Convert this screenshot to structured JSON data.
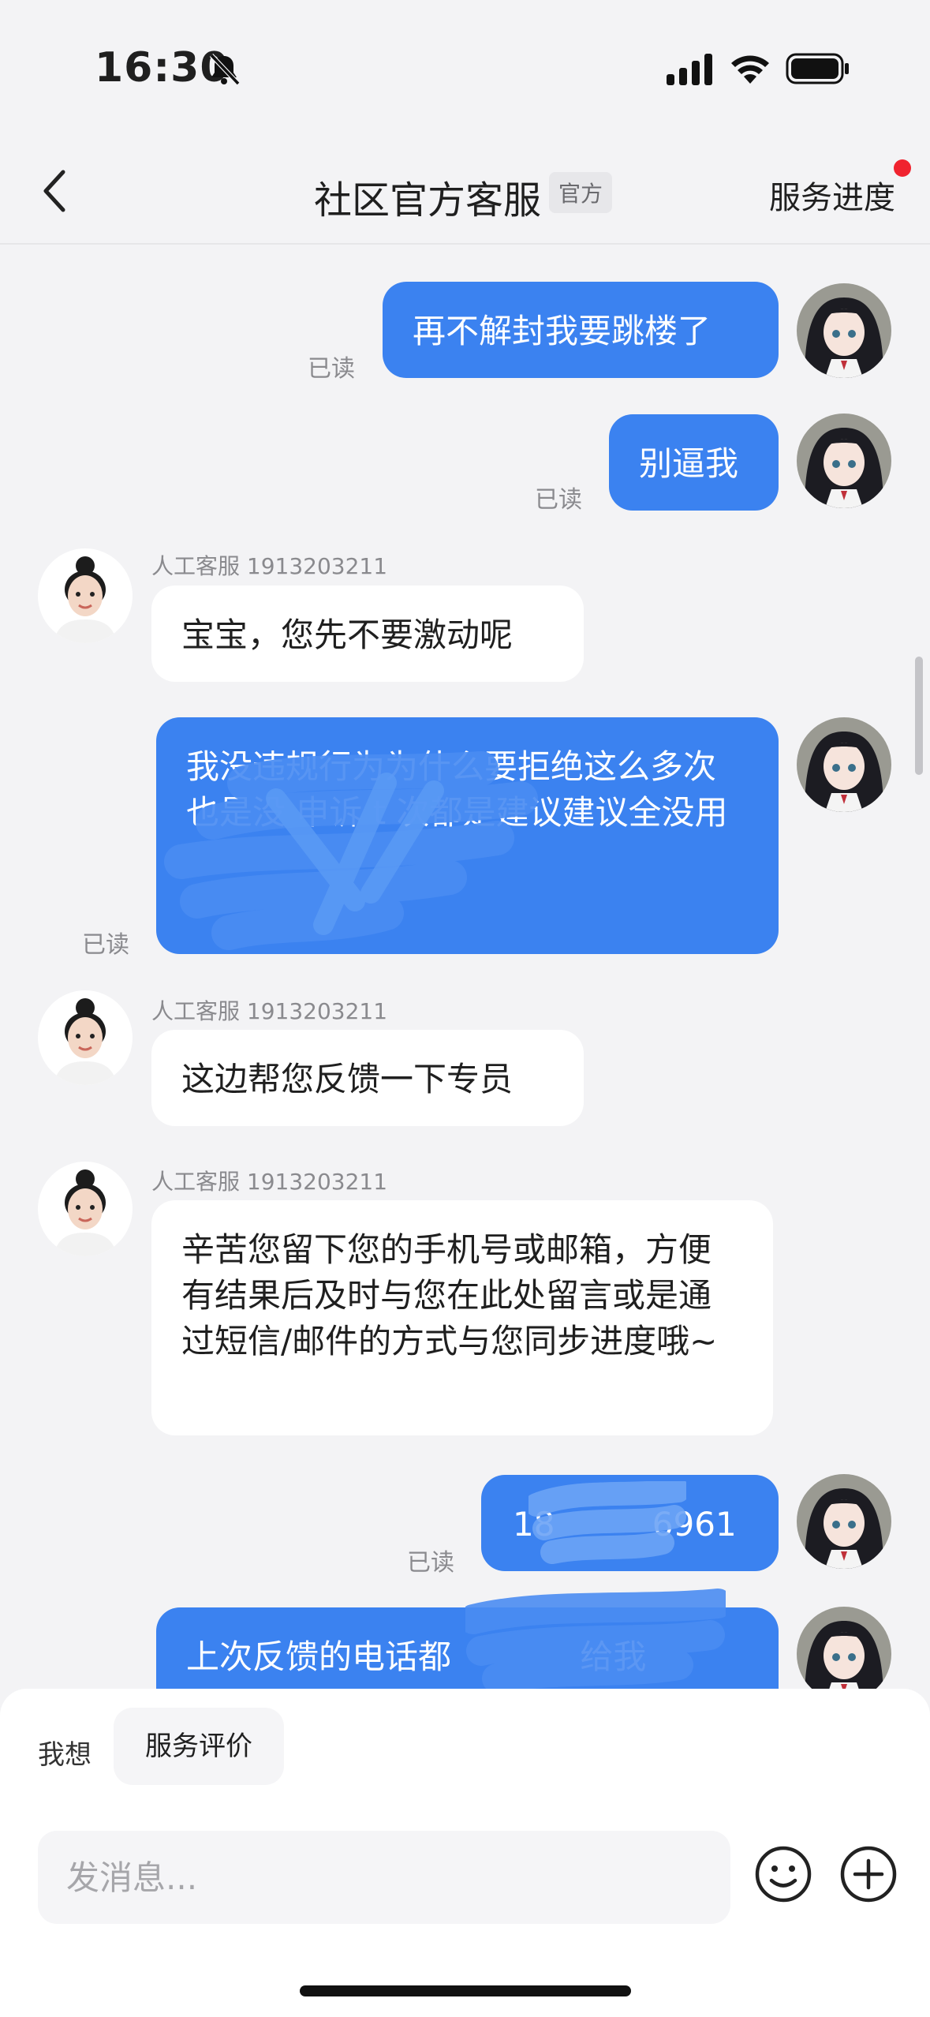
{
  "status_bar": {
    "time": "16:30"
  },
  "header": {
    "title": "社区官方客服",
    "badge": "官方",
    "right_link": "服务进度"
  },
  "messages": [
    {
      "direction": "out",
      "text": "再不解封我要跳楼了",
      "status": "已读"
    },
    {
      "direction": "out",
      "text": "别逼我",
      "status": "已读"
    },
    {
      "direction": "in",
      "sender": "人工客服 1913203211",
      "text": "宝宝，您先不要激动呢"
    },
    {
      "direction": "out",
      "text": "我没违规行为为什么要拒绝这么多次 也是没 申诉 t 次都是建议建议全没用",
      "status": "已读"
    },
    {
      "direction": "in",
      "sender": "人工客服 1913203211",
      "text": "这边帮您反馈一下专员"
    },
    {
      "direction": "in",
      "sender": "人工客服 1913203211",
      "text": "辛苦您留下您的手机号或邮箱，方便有结果后及时与您在此处留言或是通过短信/邮件的方式与您同步进度哦~"
    },
    {
      "direction": "out",
      "text": "18 6961",
      "status": "已读"
    },
    {
      "direction": "out",
      "text": "上次反馈的电话都 给我"
    }
  ],
  "quick_bar": {
    "prefix": "我想",
    "chip": "服务评价"
  },
  "composer": {
    "placeholder": "发消息..."
  },
  "colors": {
    "outgoing_bubble": "#3b82f0",
    "incoming_bubble": "#ffffff",
    "badge_dot": "#f0232f"
  },
  "icons": [
    "back-icon",
    "bell-muted-icon",
    "signal-icon",
    "wifi-icon",
    "battery-icon",
    "emoji-icon",
    "plus-icon"
  ]
}
